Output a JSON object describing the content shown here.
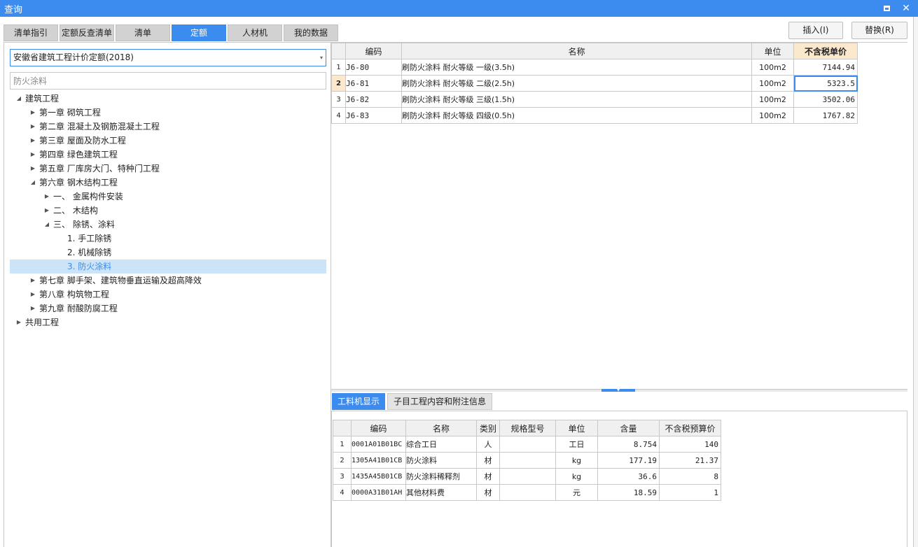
{
  "window": {
    "title": "查询"
  },
  "tabs": [
    "清单指引",
    "定额反查清单",
    "清单",
    "定额",
    "人材机",
    "我的数据"
  ],
  "buttons": {
    "insert": "插入(I)",
    "replace": "替换(R)"
  },
  "left": {
    "select_value": "安徽省建筑工程计价定额(2018)",
    "search_placeholder": "防火涂料",
    "tree": [
      {
        "label": "建筑工程",
        "level": 0,
        "state": "expanded"
      },
      {
        "label": "第一章 砌筑工程",
        "level": 1,
        "state": "collapsed"
      },
      {
        "label": "第二章 混凝土及钢筋混凝土工程",
        "level": 1,
        "state": "collapsed"
      },
      {
        "label": "第三章 屋面及防水工程",
        "level": 1,
        "state": "collapsed"
      },
      {
        "label": "第四章 绿色建筑工程",
        "level": 1,
        "state": "collapsed"
      },
      {
        "label": "第五章 厂库房大门、特种门工程",
        "level": 1,
        "state": "collapsed"
      },
      {
        "label": "第六章 钢木结构工程",
        "level": 1,
        "state": "expanded"
      },
      {
        "label": "一、 金属构件安装",
        "level": 2,
        "state": "collapsed"
      },
      {
        "label": "二、 木结构",
        "level": 2,
        "state": "collapsed"
      },
      {
        "label": "三、 除锈、涂料",
        "level": 2,
        "state": "expanded"
      },
      {
        "label": "1. 手工除锈",
        "level": 3,
        "state": "leaf"
      },
      {
        "label": "2. 机械除锈",
        "level": 3,
        "state": "leaf"
      },
      {
        "label": "3. 防火涂料",
        "level": 3,
        "state": "leaf",
        "selected": true
      },
      {
        "label": "第七章 脚手架、建筑物垂直运输及超高降效",
        "level": 1,
        "state": "collapsed"
      },
      {
        "label": "第八章 构筑物工程",
        "level": 1,
        "state": "collapsed"
      },
      {
        "label": "第九章 耐酸防腐工程",
        "level": 1,
        "state": "collapsed"
      },
      {
        "label": "共用工程",
        "level": 0,
        "state": "collapsed"
      }
    ]
  },
  "main_table": {
    "headers": [
      "",
      "编码",
      "名称",
      "单位",
      "不含税单价"
    ],
    "rows": [
      {
        "idx": "1",
        "code": "J6-80",
        "name": "刷防火涂料 耐火等级 一级(3.5h)",
        "unit": "100m2",
        "price": "7144.94"
      },
      {
        "idx": "2",
        "code": "J6-81",
        "name": "刷防火涂料 耐火等级 二级(2.5h)",
        "unit": "100m2",
        "price": "5323.5",
        "active": true
      },
      {
        "idx": "3",
        "code": "J6-82",
        "name": "刷防火涂料 耐火等级 三级(1.5h)",
        "unit": "100m2",
        "price": "3502.06"
      },
      {
        "idx": "4",
        "code": "J6-83",
        "name": "刷防火涂料 耐火等级 四级(0.5h)",
        "unit": "100m2",
        "price": "1767.82"
      }
    ]
  },
  "sub_tabs": [
    "工料机显示",
    "子目工程内容和附注信息"
  ],
  "bottom_table": {
    "headers": [
      "",
      "编码",
      "名称",
      "类别",
      "规格型号",
      "单位",
      "含量",
      "不含税预算价"
    ],
    "rows": [
      {
        "idx": "1",
        "code": "0001A01B01BC",
        "name": "综合工日",
        "category": "人",
        "spec": "",
        "unit": "工日",
        "qty": "8.754",
        "price": "140"
      },
      {
        "idx": "2",
        "code": "1305A41B01CB",
        "name": "防火涂料",
        "category": "材",
        "spec": "",
        "unit": "kg",
        "qty": "177.19",
        "price": "21.37"
      },
      {
        "idx": "3",
        "code": "1435A45B01CB",
        "name": "防火涂料稀释剂",
        "category": "材",
        "spec": "",
        "unit": "kg",
        "qty": "36.6",
        "price": "8"
      },
      {
        "idx": "4",
        "code": "0000A31B01AH",
        "name": "其他材料费",
        "category": "材",
        "spec": "",
        "unit": "元",
        "qty": "18.59",
        "price": "1"
      }
    ]
  },
  "colors": {
    "accent": "#3c8cf0",
    "header_highlight": "#fce8cc",
    "selected_bg": "#cce4f7"
  }
}
